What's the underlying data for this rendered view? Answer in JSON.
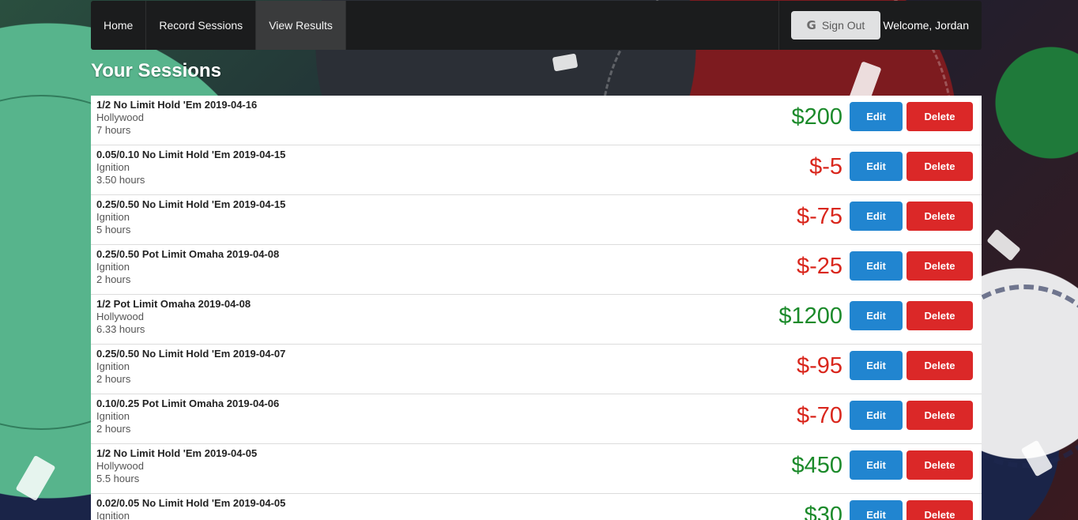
{
  "colors": {
    "nav_bg": "#1b1c1d",
    "positive": "#1b8a2a",
    "negative": "#d9261c",
    "edit_button": "#2185d0",
    "delete_button": "#db2828"
  },
  "nav": {
    "items": [
      {
        "label": "Home"
      },
      {
        "label": "Record Sessions"
      },
      {
        "label": "View Results",
        "active": true
      }
    ],
    "signout_icon": "google-g-icon",
    "signout_label": "Sign Out",
    "welcome": "Welcome, Jordan"
  },
  "page_title": "Your Sessions",
  "buttons": {
    "edit": "Edit",
    "delete": "Delete"
  },
  "sessions": [
    {
      "title": "1/2 No Limit Hold 'Em 2019-04-16",
      "venue": "Hollywood",
      "duration": "7 hours",
      "amount": "$200",
      "positive": true
    },
    {
      "title": "0.05/0.10 No Limit Hold 'Em 2019-04-15",
      "venue": "Ignition",
      "duration": "3.50 hours",
      "amount": "$-5",
      "positive": false
    },
    {
      "title": "0.25/0.50 No Limit Hold 'Em 2019-04-15",
      "venue": "Ignition",
      "duration": "5 hours",
      "amount": "$-75",
      "positive": false
    },
    {
      "title": "0.25/0.50 Pot Limit Omaha 2019-04-08",
      "venue": "Ignition",
      "duration": "2 hours",
      "amount": "$-25",
      "positive": false
    },
    {
      "title": "1/2 Pot Limit Omaha 2019-04-08",
      "venue": "Hollywood",
      "duration": "6.33 hours",
      "amount": "$1200",
      "positive": true
    },
    {
      "title": "0.25/0.50 No Limit Hold 'Em 2019-04-07",
      "venue": "Ignition",
      "duration": "2 hours",
      "amount": "$-95",
      "positive": false
    },
    {
      "title": "0.10/0.25 Pot Limit Omaha 2019-04-06",
      "venue": "Ignition",
      "duration": "2 hours",
      "amount": "$-70",
      "positive": false
    },
    {
      "title": "1/2 No Limit Hold 'Em 2019-04-05",
      "venue": "Hollywood",
      "duration": "5.5 hours",
      "amount": "$450",
      "positive": true
    },
    {
      "title": "0.02/0.05 No Limit Hold 'Em 2019-04-05",
      "venue": "Ignition",
      "duration": "",
      "amount": "$30",
      "positive": true
    }
  ]
}
